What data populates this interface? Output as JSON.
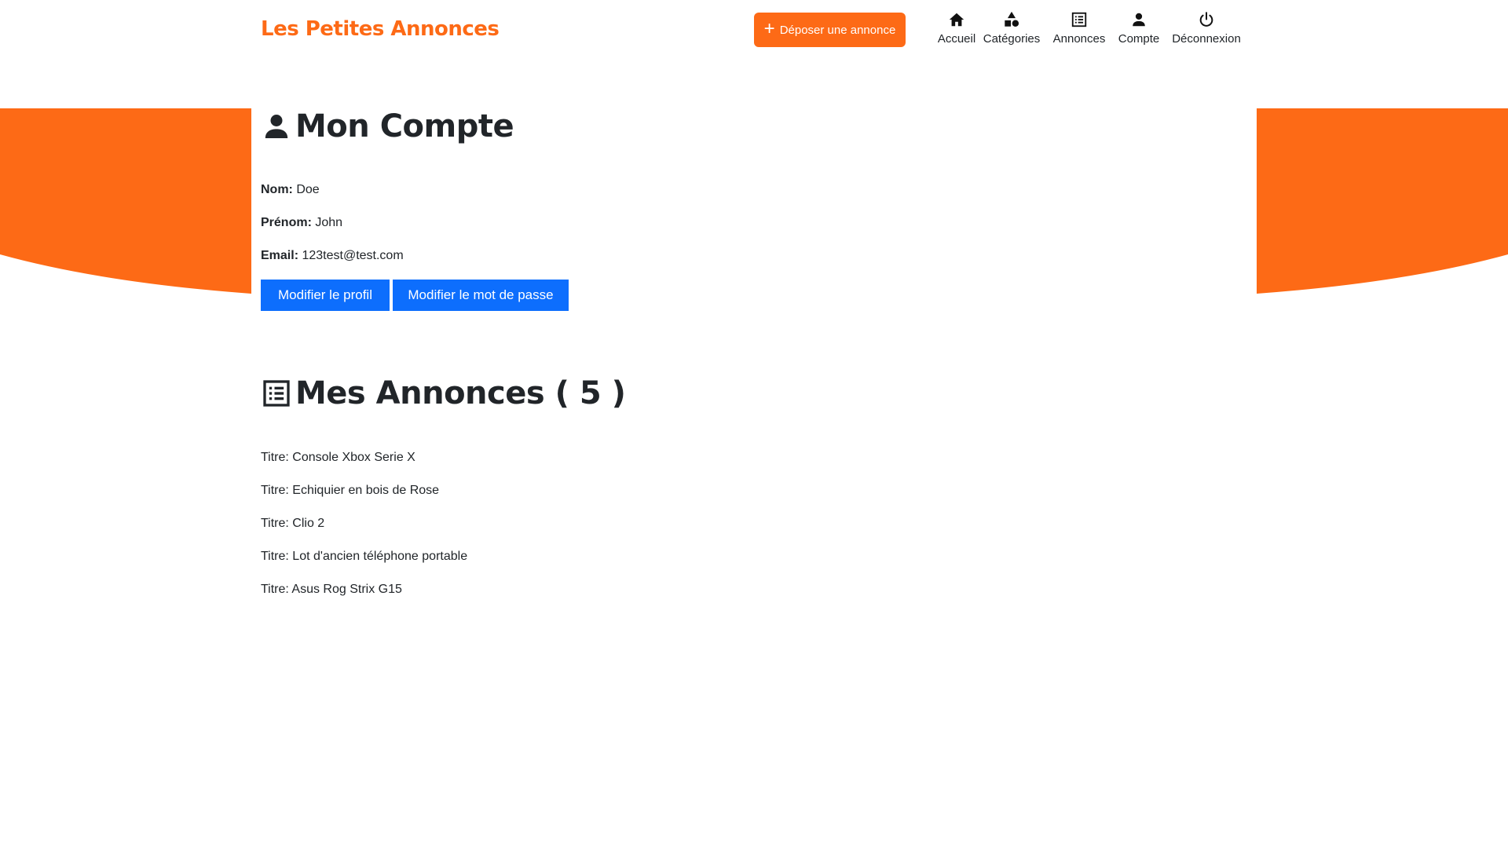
{
  "header": {
    "brand": "Les Petites Annonces",
    "post_button": "Déposer une annonce",
    "nav": [
      {
        "label": "Accueil",
        "icon": "home-icon"
      },
      {
        "label": "Catégories",
        "icon": "shapes-icon"
      },
      {
        "label": "Annonces",
        "icon": "list-icon"
      },
      {
        "label": "Compte",
        "icon": "user-icon"
      },
      {
        "label": "Déconnexion",
        "icon": "power-icon"
      }
    ]
  },
  "account": {
    "title": "Mon Compte",
    "fields": [
      {
        "label": "Nom:",
        "value": "Doe"
      },
      {
        "label": "Prénom:",
        "value": "John"
      },
      {
        "label": "Email:",
        "value": "123test@test.com"
      }
    ],
    "edit_profile_button": "Modifier le profil",
    "edit_password_button": "Modifier le mot de passe"
  },
  "ads": {
    "title": "Mes Annonces ( 5 )",
    "items": [
      "Titre: Console Xbox Serie X",
      "Titre: Echiquier en bois de Rose",
      "Titre: Clio 2",
      "Titre: Lot d'ancien téléphone portable",
      "Titre: Asus Rog Strix G15"
    ]
  },
  "colors": {
    "accent": "#fd6a16",
    "primary_button": "#0d6efd",
    "text": "#212529"
  }
}
